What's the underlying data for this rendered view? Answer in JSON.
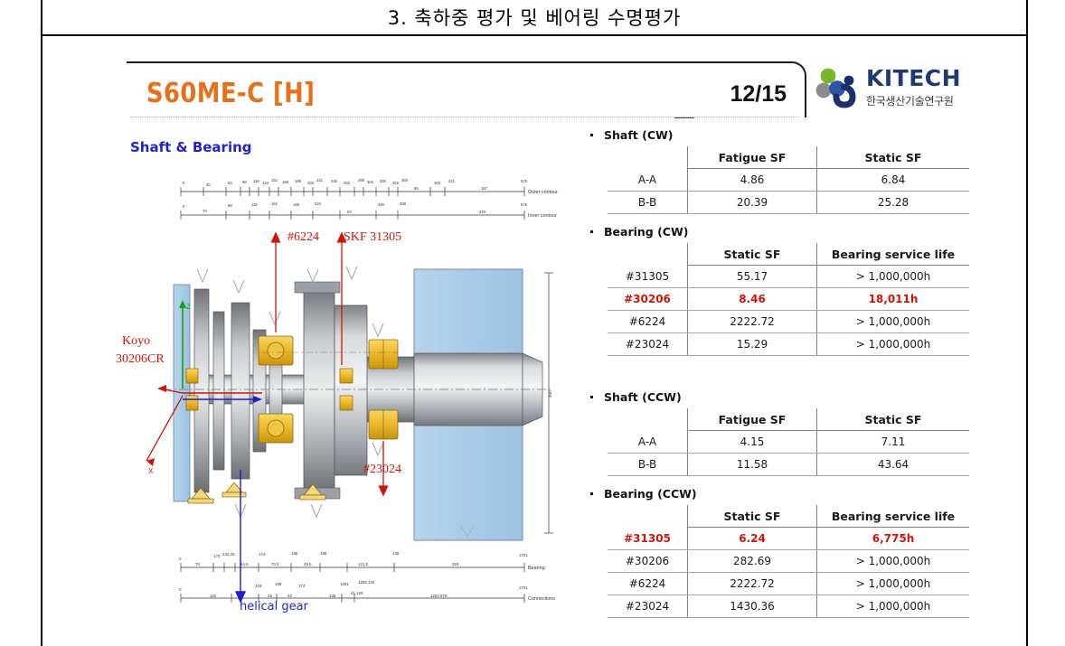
{
  "slide": {
    "section_title": "3. 축하중 평가 및 베어링 수명평가",
    "deck_title": "S60ME-C [H]",
    "page_indicator": "12/15"
  },
  "logo": {
    "wordmark": "KITECH",
    "subtext": "한국생산기술연구원",
    "colors": {
      "navy": "#1F3A73",
      "green": "#7AB629",
      "gray": "#8C8C8C",
      "deep_navy": "#1B2F6B"
    }
  },
  "left_pane": {
    "heading": "Shaft & Bearing",
    "annotations": {
      "bearing_6224": "#6224",
      "skf_31305": "SKF 31305",
      "koyo_line1": "Koyo",
      "koyo_line2": "30206CR",
      "bearing_23024": "#23024",
      "helical_gear": "helical gear",
      "axis_z": "Z",
      "axis_x": "X"
    },
    "dimension_rows": {
      "outer_contour": "Outer contour",
      "inner_contour": "Inner contour",
      "bearing": "Bearing",
      "connections": "Connections"
    }
  },
  "tables": [
    {
      "caption": "Shaft (CW)",
      "headers": [
        "",
        "Fatigue SF",
        "Static SF"
      ],
      "rows": [
        {
          "cells": [
            "A-A",
            "4.86",
            "6.84"
          ],
          "highlight": false
        },
        {
          "cells": [
            "B-B",
            "20.39",
            "25.28"
          ],
          "highlight": false
        }
      ]
    },
    {
      "caption": "Bearing (CW)",
      "headers": [
        "",
        "Static SF",
        "Bearing service life"
      ],
      "rows": [
        {
          "cells": [
            "#31305",
            "55.17",
            "> 1,000,000h"
          ],
          "highlight": false
        },
        {
          "cells": [
            "#30206",
            "8.46",
            "18,011h"
          ],
          "highlight": true
        },
        {
          "cells": [
            "#6224",
            "2222.72",
            "> 1,000,000h"
          ],
          "highlight": false
        },
        {
          "cells": [
            "#23024",
            "15.29",
            "> 1,000,000h"
          ],
          "highlight": false
        }
      ]
    },
    {
      "caption": "Shaft (CCW)",
      "headers": [
        "",
        "Fatigue SF",
        "Static SF"
      ],
      "rows": [
        {
          "cells": [
            "A-A",
            "4.15",
            "7.11"
          ],
          "highlight": false
        },
        {
          "cells": [
            "B-B",
            "11.58",
            "43.64"
          ],
          "highlight": false
        }
      ]
    },
    {
      "caption": "Bearing (CCW)",
      "headers": [
        "",
        "Static SF",
        "Bearing service life"
      ],
      "rows": [
        {
          "cells": [
            "#31305",
            "6.24",
            "6,775h"
          ],
          "highlight": true
        },
        {
          "cells": [
            "#30206",
            "282.69",
            "> 1,000,000h"
          ],
          "highlight": false
        },
        {
          "cells": [
            "#6224",
            "2222.72",
            "> 1,000,000h"
          ],
          "highlight": false
        },
        {
          "cells": [
            "#23024",
            "1430.36",
            "> 1,000,000h"
          ],
          "highlight": false
        }
      ]
    }
  ],
  "colors": {
    "title_orange": "#E8701A",
    "heading_blue": "#2222CC",
    "alert_red": "#D11408",
    "housing_blue": "#A9CCE8",
    "bearing_gold": "#E8B923"
  }
}
